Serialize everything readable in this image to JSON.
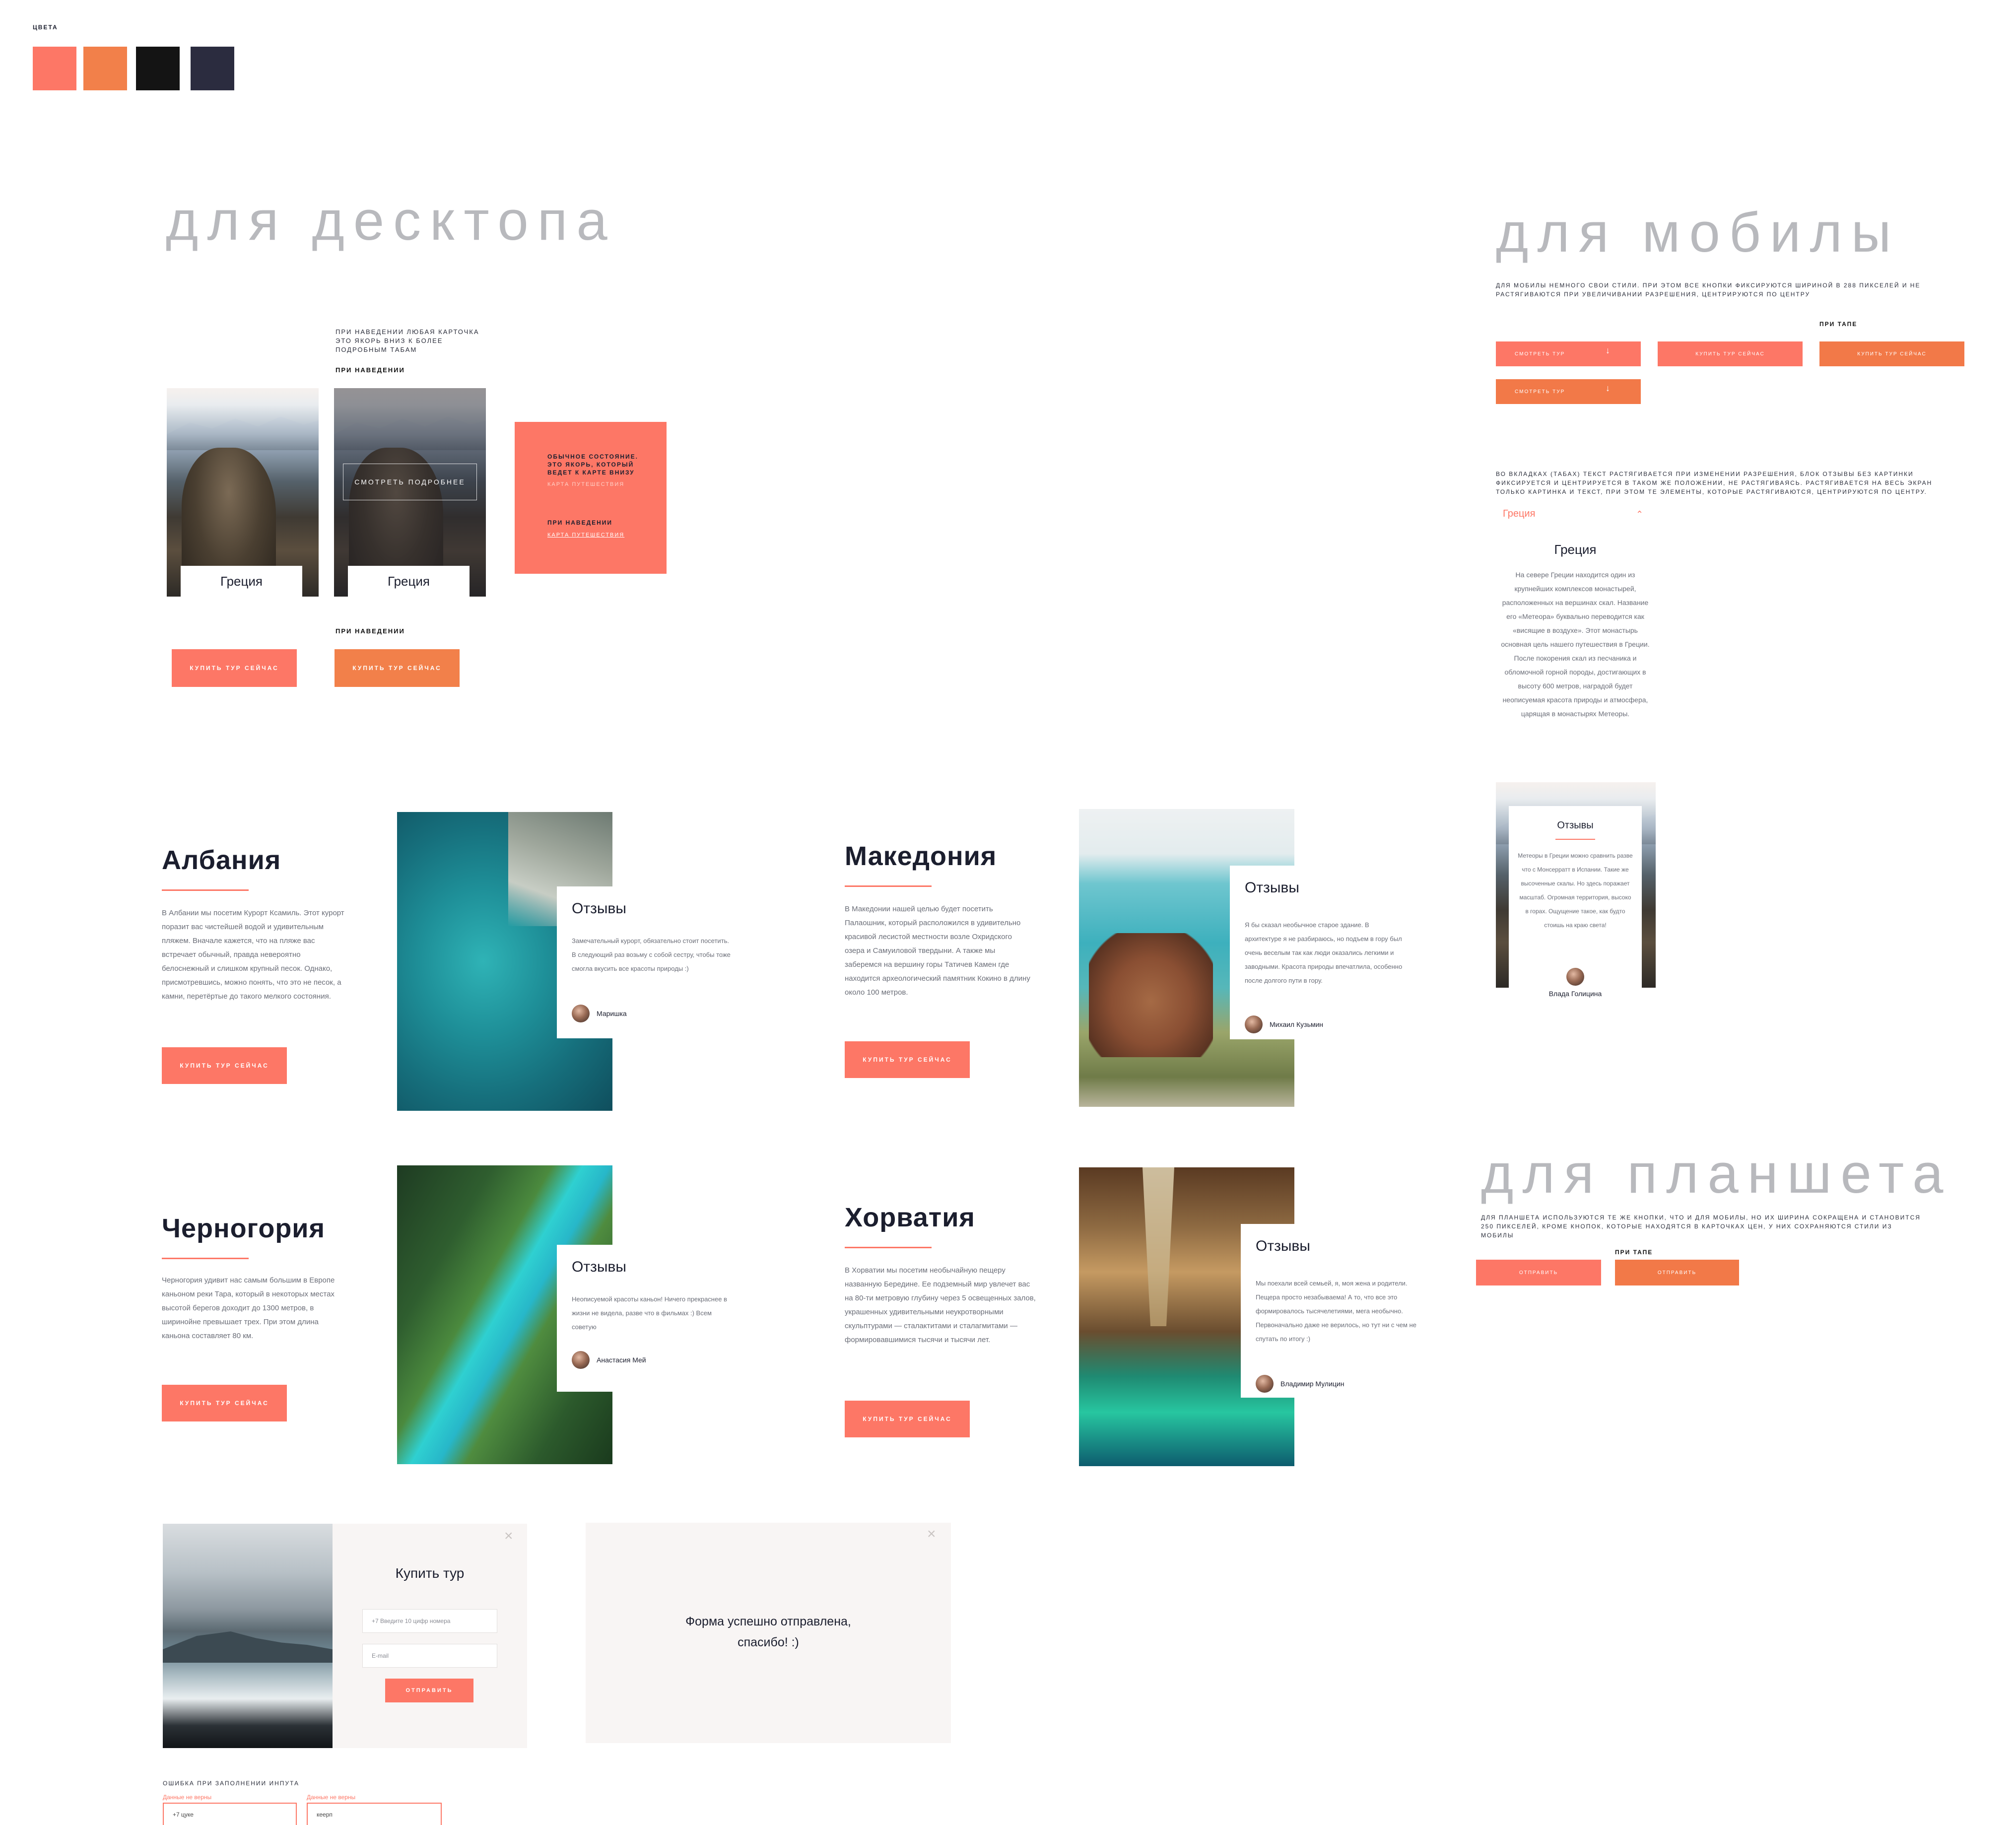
{
  "colors": {
    "label": "цвета",
    "swatches": [
      "#fd7766",
      "#f2804a",
      "#141414",
      "#2b2c3f"
    ]
  },
  "desktop": {
    "title": "для десктопа",
    "note_hover_card": "при наведении любая карточка это якорь вниз к более подробным табам",
    "note_hover": "при наведении",
    "note_hover_button": "при наведении",
    "card_label": "Греция",
    "card_hover_button": "смотреть подробнее",
    "map_card": {
      "normal_title": "обычное состояние. это якорь, который ведет к карте внизу",
      "normal_link": "карта путешествия",
      "hover_title": "при наведении",
      "hover_link": "карта путешествия"
    },
    "buy_button": "купить тур сейчас",
    "buy_button_hover": "купить тур сейчас"
  },
  "countries": [
    {
      "name": "Албания",
      "text": "В Албании мы посетим Курорт Ксамиль. Этот курорт поразит вас чистейшей водой и удивительным пляжем. Вначале кажется, что на пляже вас встречает обычный, правда невероятно белоснежный и слишком крупный песок. Однако, присмотревшись, можно понять, что это не песок, а камни, перетёртые до такого мелкого состояния.",
      "button": "купить тур сейчас",
      "review_title": "Отзывы",
      "review_text": "Замечательный курорт, обязательно стоит посетить. В следующий раз возьму с собой сестру, чтобы тоже смогла вкусить все красоты природы :)",
      "reviewer": "Маришка"
    },
    {
      "name": "Македония",
      "text": "В Македонии нашей целью будет посетить Палаошник, который расположился в удивительно красивой лесистой местности возле Охридского озера и Самуиловой твердыни. А также мы заберемся на вершину горы Татичев Камен где находится археологический памятник Кокино в длину около 100 метров.",
      "button": "купить тур сейчас",
      "review_title": "Отзывы",
      "review_text": "Я бы сказал необычное старое здание. В архитектуре я не разбираюсь, но подъем в гору был очень веселым так как люди оказались легкими и заводными. Красота природы впечатлила, особенно после долгого пути в гору.",
      "reviewer": "Михаил Кузьмин"
    },
    {
      "name": "Черногория",
      "text": "Черногория удивит нас самым большим в Европе каньоном реки Тара, который в некоторых местах высотой берегов доходит до 1300 метров, в ширинойне превышает трех. При этом длина каньона составляет 80 км.",
      "button": "купить тур сейчас",
      "review_title": "Отзывы",
      "review_text": "Неописуемой красоты каньон! Ничего прекраснее в жизни не видела, разве что в фильмах :) Всем советую",
      "reviewer": "Анастасия Мей"
    },
    {
      "name": "Хорватия",
      "text": "В Хорватии мы посетим необычайную пещеру названную Бередине. Ее подземный мир увлечет вас на 80-ти метровую глубину через 5 освещенных залов, украшенных удивительными неукротворными скульптурами — сталактитами и сталагмитами — формировавшимися тысячи и тысячи лет.",
      "button": "купить тур сейчас",
      "review_title": "Отзывы",
      "review_text": "Мы поехали всей семьей, я, моя жена и родители. Пещера просто незабываема! А то, что все это формировалось тысячелетиями, мега необычно. Первоначально даже не верилось, но тут ни с чем не спутать по итогу :)",
      "reviewer": "Владимир Мулицин"
    }
  ],
  "modal": {
    "title": "Купить тур",
    "phone_placeholder": "+7  Введите 10 цифр номера",
    "email_placeholder": "E-mail",
    "submit": "отправить",
    "success": "Форма успешно отправлена, спасибо! :)",
    "close": "×"
  },
  "errors": {
    "label": "ошибка при заполнении инпута",
    "field1_label": "Данные не верны",
    "field1_value": "+7  цуке",
    "field2_label": "Данные не верны",
    "field2_value": "кеерп"
  },
  "mobile": {
    "title": "для мобилы",
    "note_buttons": "для мобилы немного свои стили. при этом все кнопки фиксируются шириной в 288 пикселей и не растягиваются при увеличивании разрешения, центрируются по центру",
    "note_tap": "при тапе",
    "btn_view": "смотреть тур",
    "btn_buy": "купить тур сейчас",
    "btn_buy_tap": "купить тур сейчас",
    "btn_view_tap": "смотреть тур",
    "arrow": "↓",
    "note_tabs": "во вкладках (табах) текст растягивается при изменении разрешения, блок отзывы без картинки фиксируется и центрируется в таком же положении, не растягиваясь. растягивается на весь экран только картинка и текст, при этом те элементы, которые растягиваются, центрируются по центру.",
    "tab_label": "Греция",
    "tab_chevron": "⌃",
    "tab_title": "Греция",
    "tab_text": "На севере Греции находится один из крупнейших комплексов монастырей, расположенных на вершинах скал. Название его «Метеора» буквально переводится как «висящие в воздухе». Этот монастырь основная цель нашего путешествия в Греции. После покорения скал из песчаника и обломочной горной породы, достигающих в высоту 600 метров, наградой будет неописуемая красота природы и атмосфера, царящая в монастырях Метеоры.",
    "review_title": "Отзывы",
    "review_text": "Метеоры в Греции можно сравнить разве что с Монсерратт в Испании. Такие же высоченные скалы. Но здесь поражает масштаб. Огромная территория, высоко в горах. Ощущение такое, как будто стоишь на краю света!",
    "reviewer": "Влада Голицина"
  },
  "tablet": {
    "title": "для планшета",
    "note": "для планшета используются те же кнопки, что и для мобилы, но их ширина сокращена и становится 250 пикселей, кроме кнопок, которые находятся в карточках цен, у них сохраняются стили из мобилы",
    "note_tap": "при тапе",
    "btn_send": "отправить",
    "btn_send_tap": "отправить"
  }
}
